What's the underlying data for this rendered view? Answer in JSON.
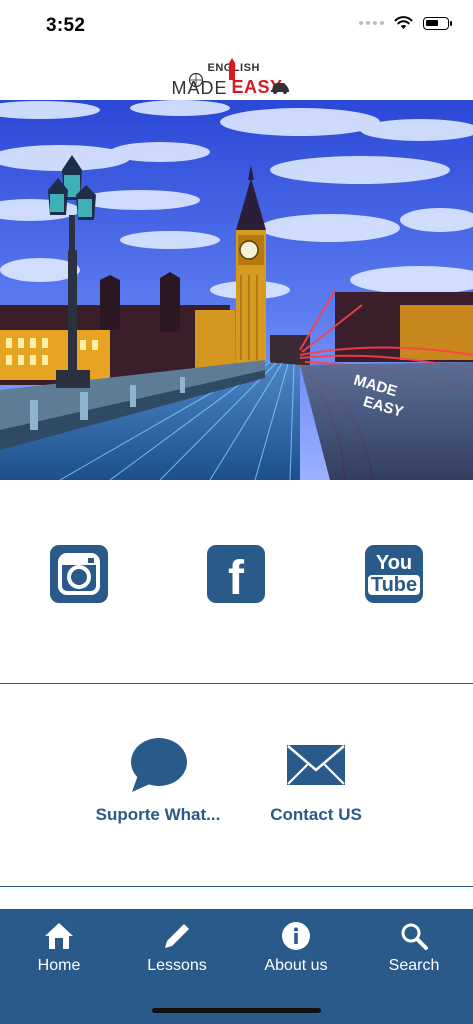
{
  "status": {
    "time": "3:52"
  },
  "logo": {
    "top_word": "ENGLISH",
    "made_word": "MADE",
    "easy_word": "EASY"
  },
  "hero": {
    "road_text_line1": "MADE",
    "road_text_line2": "EASY"
  },
  "social": [
    {
      "name": "instagram",
      "icon": "instagram-icon"
    },
    {
      "name": "facebook",
      "icon": "facebook-icon",
      "glyph": "f"
    },
    {
      "name": "youtube",
      "icon": "youtube-icon",
      "text_top": "You",
      "text_bottom": "Tube"
    }
  ],
  "contact": {
    "whatsapp_label": "Suporte What...",
    "email_label": "Contact US"
  },
  "tabs": [
    {
      "label": "Home",
      "icon": "home-icon"
    },
    {
      "label": "Lessons",
      "icon": "pencil-icon"
    },
    {
      "label": "About us",
      "icon": "info-icon"
    },
    {
      "label": "Search",
      "icon": "search-icon"
    }
  ],
  "colors": {
    "brand": "#2a5a8a",
    "logo_red": "#d71920",
    "background": "#ffffff"
  }
}
